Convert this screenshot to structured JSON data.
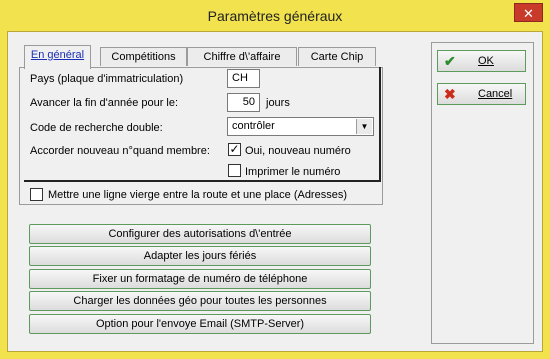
{
  "window": {
    "title": "Paramètres généraux",
    "close_glyph": "✕"
  },
  "tabs": [
    {
      "label": "En général"
    },
    {
      "label": "Compétitions"
    },
    {
      "label": "Chiffre d\\'affaire"
    },
    {
      "label": "Carte Chip"
    }
  ],
  "form": {
    "country_label": "Pays (plaque d'immatriculation)",
    "country_value": "CH",
    "year_end_label": "Avancer la fin d'année pour le:",
    "year_end_value": "50",
    "year_end_unit": "jours",
    "dup_search_label": "Code de recherche double:",
    "dup_search_value": "contrôler",
    "new_number_label": "Accorder nouveau n°quand membre:",
    "new_number_option": "Oui, nouveau numéro",
    "new_number_checked": true,
    "print_number_option": "Imprimer le numéro",
    "print_number_checked": false,
    "blank_line_label": "Mettre une ligne vierge entre la route et une place (Adresses)",
    "blank_line_checked": false
  },
  "actions": [
    {
      "label": "Configurer des autorisations d\\'entrée"
    },
    {
      "label": "Adapter les jours fériés"
    },
    {
      "label": "Fixer un formatage de numéro de téléphone"
    },
    {
      "label": "Charger les données géo pour toutes les personnes"
    },
    {
      "label": "Option pour l'envoye Email (SMTP-Server)"
    }
  ],
  "buttons": {
    "ok": {
      "label": "OK",
      "icon": "check-icon",
      "color": "#2e8b2e"
    },
    "cancel": {
      "label": "Cancel",
      "icon": "x-icon",
      "color": "#cc2a1a"
    }
  },
  "colors": {
    "title_bar": "#f2e24e",
    "button_border": "#5d9b5d"
  }
}
